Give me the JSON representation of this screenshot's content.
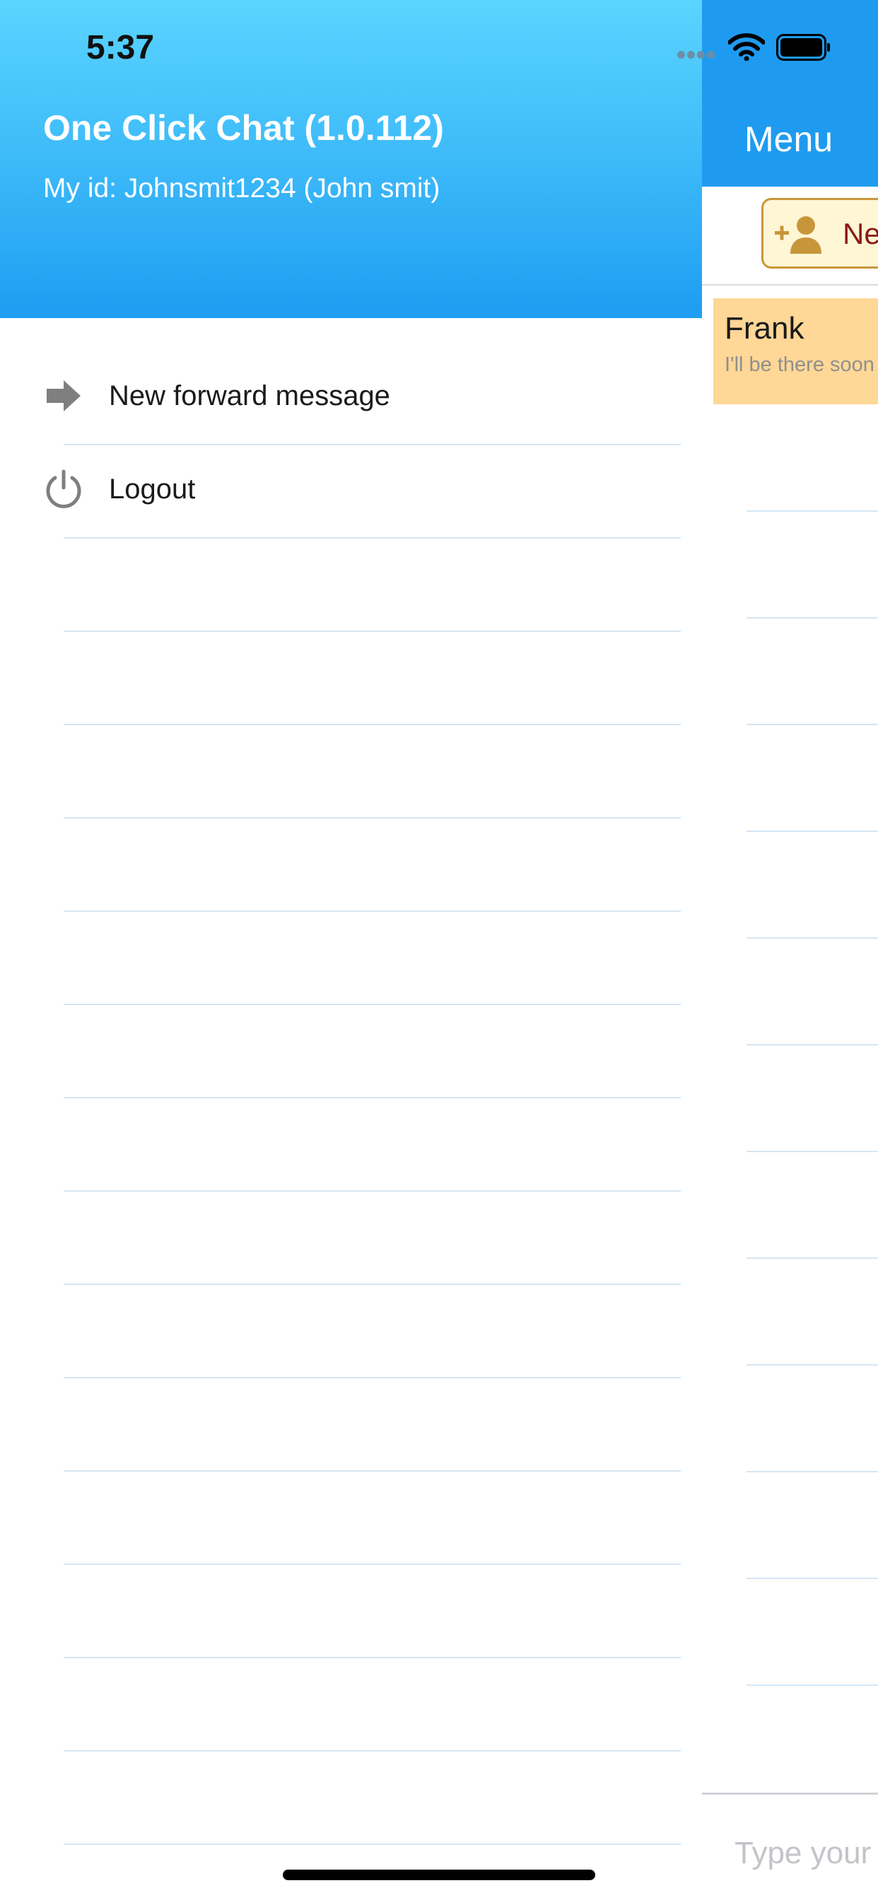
{
  "status_bar": {
    "time": "5:37"
  },
  "drawer": {
    "app_title": "One Click Chat (1.0.112)",
    "my_id": "My id: Johnsmit1234 (John smit)",
    "menu_items": [
      {
        "label": "New forward message",
        "icon": "forward-arrow-icon"
      },
      {
        "label": "Logout",
        "icon": "power-icon"
      }
    ]
  },
  "main": {
    "title": "Menu",
    "new_contact_label": "New",
    "conversations": [
      {
        "name": "Frank",
        "preview": "I'll be there soon"
      }
    ],
    "message_placeholder": "Type your message"
  },
  "colors": {
    "header_blue": "#1E9BF0",
    "header_gradient_top": "#5AD4FF",
    "conversation_highlight": "#FFD796",
    "new_button_fill": "#FFF6D5",
    "new_button_border": "#C8963A",
    "new_button_text": "#8B1A1A"
  }
}
